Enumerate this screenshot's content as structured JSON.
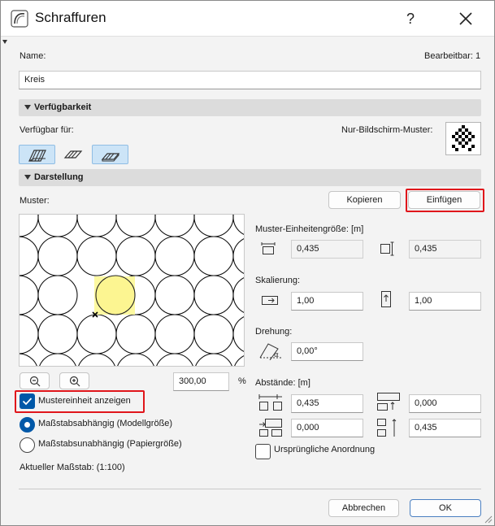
{
  "window": {
    "title": "Schraffuren",
    "help_label": "?"
  },
  "header": {
    "name_label": "Name:",
    "editable_label": "Bearbeitbar: 1",
    "name_value": "Kreis"
  },
  "availability": {
    "section_title": "Verfügbarkeit",
    "available_for_label": "Verfügbar für:",
    "screen_only_label": "Nur-Bildschirm-Muster:",
    "toggles": [
      {
        "icon": "cut-fill-icon",
        "active": true
      },
      {
        "icon": "drafting-fill-icon",
        "active": false
      },
      {
        "icon": "cover-fill-icon",
        "active": true
      }
    ]
  },
  "display": {
    "section_title": "Darstellung",
    "pattern_label": "Muster:",
    "copy_label": "Kopieren",
    "paste_label": "Einfügen",
    "zoom_value": "300,00",
    "zoom_unit": "%",
    "show_unit_label": "Mustereinheit anzeigen",
    "show_unit_checked": true,
    "scale_dependent_label": "Maßstabsabhängig (Modellgröße)",
    "scale_independent_label": "Maßstabsunabhängig (Papiergröße)",
    "scale_dependent_selected": true,
    "current_scale_label": "Aktueller Maßstab: (1:100)"
  },
  "unit_size": {
    "label": "Muster-Einheitengröße: [m]",
    "width": "0,435",
    "height": "0,435"
  },
  "scaling": {
    "label": "Skalierung:",
    "x": "1,00",
    "y": "1,00"
  },
  "rotation": {
    "label": "Drehung:",
    "value": "0,00°"
  },
  "spacing": {
    "label": "Abstände: [m]",
    "horizontal": "0,435",
    "vertical_offset": "0,000",
    "horizontal_offset": "0,000",
    "vertical": "0,435"
  },
  "original_arrangement": {
    "label": "Ursprüngliche Anordnung",
    "checked": false
  },
  "footer": {
    "cancel_label": "Abbrechen",
    "ok_label": "OK"
  },
  "colors": {
    "accent": "#0058a8",
    "highlight_red": "#e0161b",
    "unit_cell_fill": "#fdf9a0",
    "toggle_active": "#cce4f7"
  }
}
